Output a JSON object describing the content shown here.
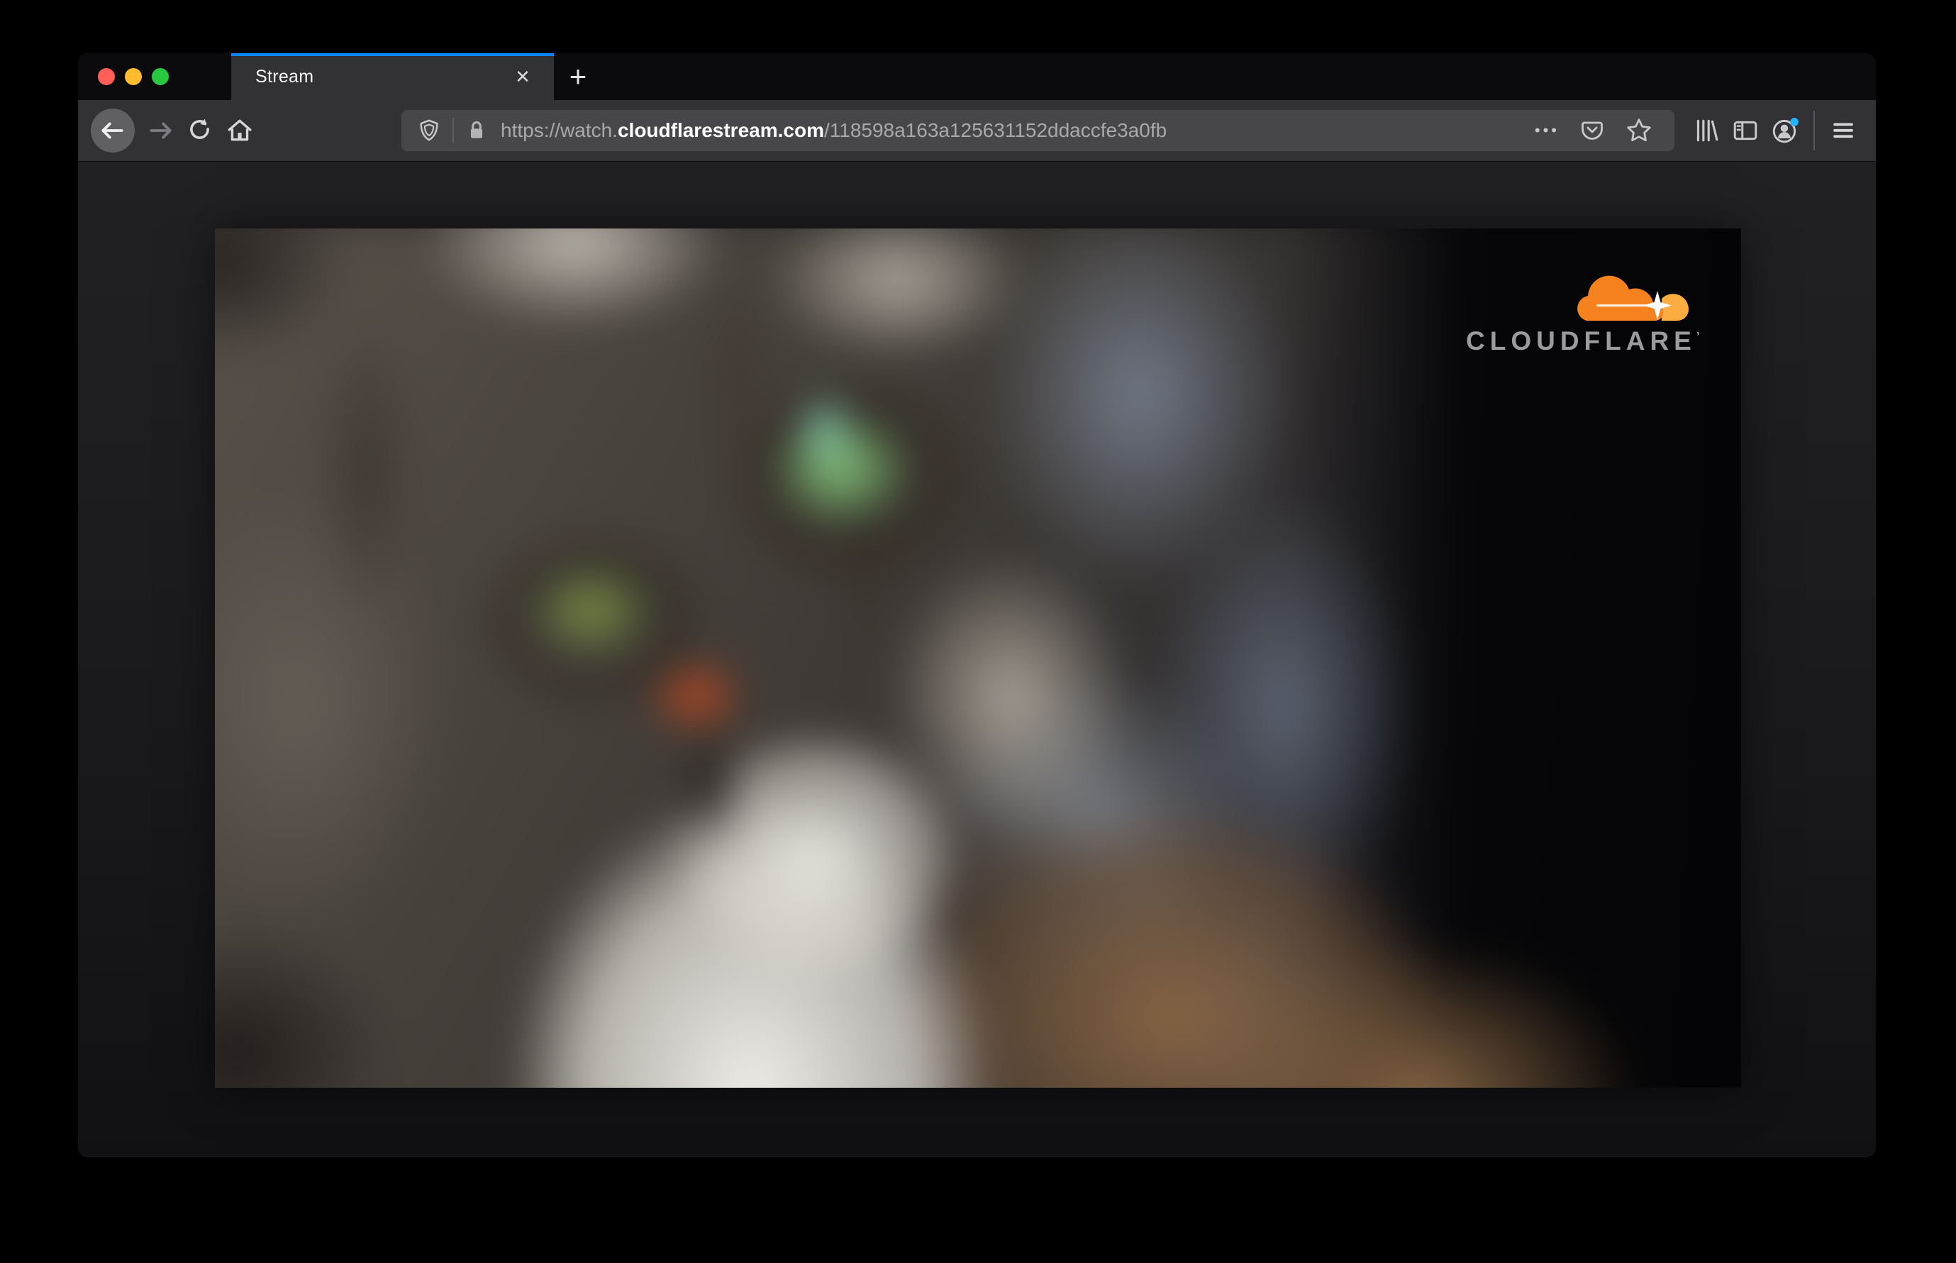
{
  "window": {
    "traffic_lights": {
      "close_color": "#ff5f57",
      "minimize_color": "#febc2e",
      "zoom_color": "#28c840"
    },
    "tab_strip": {
      "new_tab_glyph": "+"
    },
    "tab": {
      "title": "Stream",
      "close_glyph": "✕",
      "active_indicator_color": "#0a84ff"
    },
    "toolbar": {
      "page_actions_glyph": "•••",
      "url": {
        "scheme_and_subdomain": "https://watch.",
        "domain": "cloudflarestream.com",
        "path": "/118598a163a125631152ddaccfe3a0fb"
      },
      "account_badge_color": "#1fb6ff"
    }
  },
  "page": {
    "video": {
      "description": "Blurred close-up of a grey tabby cat with green eyes",
      "logo": {
        "text": "CLOUDFLARE",
        "mark": "’",
        "cloud_color": "#f6821f",
        "cloud_light_color": "#fbad41",
        "text_color": "#9b9b9b"
      }
    }
  }
}
